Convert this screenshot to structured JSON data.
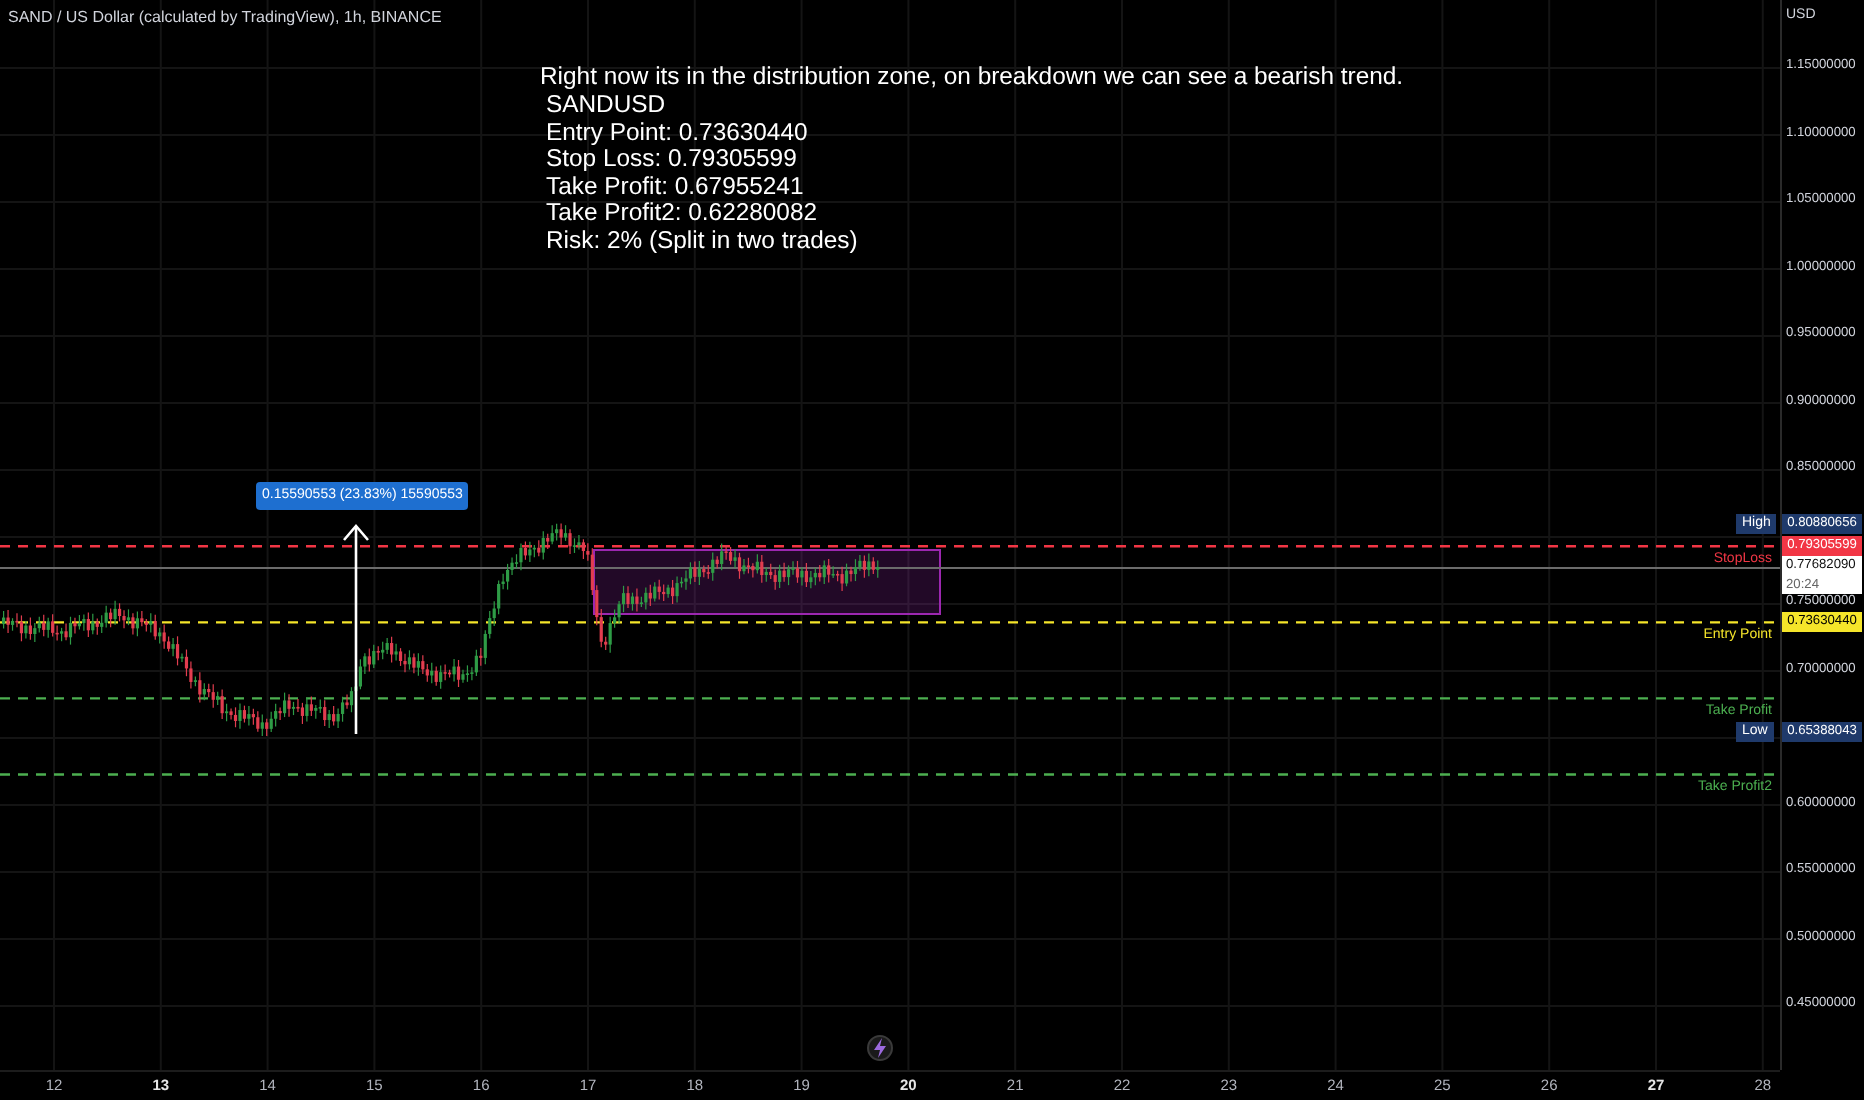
{
  "header": {
    "title": "SAND / US Dollar (calculated by TradingView), 1h, BINANCE"
  },
  "note": {
    "headline": "Right now its in the distribution zone, on breakdown we can see a bearish trend.",
    "lines": [
      "SANDUSD",
      "Entry Point: 0.73630440",
      "Stop Loss: 0.79305599",
      "Take Profit: 0.67955241",
      "Take Profit2: 0.62280082",
      "Risk: 2% (Split in two trades)"
    ]
  },
  "measure": {
    "label": "0.15590553 (23.83%) 15590553"
  },
  "lines": [
    {
      "label": "StopLoss",
      "color": "#f23645"
    },
    {
      "label": "Entry Point",
      "color": "#f5e52a"
    },
    {
      "label": "Take Profit",
      "color": "#4caf50"
    },
    {
      "label": "Take Profit2",
      "color": "#4caf50"
    }
  ],
  "price_axis": {
    "unit": "USD",
    "ticks": [
      "1.15000000",
      "1.10000000",
      "1.05000000",
      "1.00000000",
      "0.95000000",
      "0.90000000",
      "0.85000000",
      "0.75000000",
      "0.70000000",
      "0.60000000",
      "0.55000000",
      "0.50000000",
      "0.45000000"
    ]
  },
  "price_labels": [
    {
      "kind": "high",
      "tag": "High",
      "value": "0.80880656"
    },
    {
      "kind": "stop",
      "value": "0.79305599"
    },
    {
      "kind": "last",
      "value": "0.77682090",
      "countdown": "20:24"
    },
    {
      "kind": "entry",
      "value": "0.73630440"
    },
    {
      "kind": "low",
      "tag": "Low",
      "value": "0.65388043"
    }
  ],
  "time_axis": {
    "ticks": [
      {
        "label": "12",
        "bold": false
      },
      {
        "label": "13",
        "bold": true
      },
      {
        "label": "14",
        "bold": false
      },
      {
        "label": "15",
        "bold": false
      },
      {
        "label": "16",
        "bold": false
      },
      {
        "label": "17",
        "bold": false
      },
      {
        "label": "18",
        "bold": false
      },
      {
        "label": "19",
        "bold": false
      },
      {
        "label": "20",
        "bold": true
      },
      {
        "label": "21",
        "bold": false
      },
      {
        "label": "22",
        "bold": false
      },
      {
        "label": "23",
        "bold": false
      },
      {
        "label": "24",
        "bold": false
      },
      {
        "label": "25",
        "bold": false
      },
      {
        "label": "26",
        "bold": false
      },
      {
        "label": "27",
        "bold": true
      },
      {
        "label": "28",
        "bold": false
      }
    ]
  }
}
